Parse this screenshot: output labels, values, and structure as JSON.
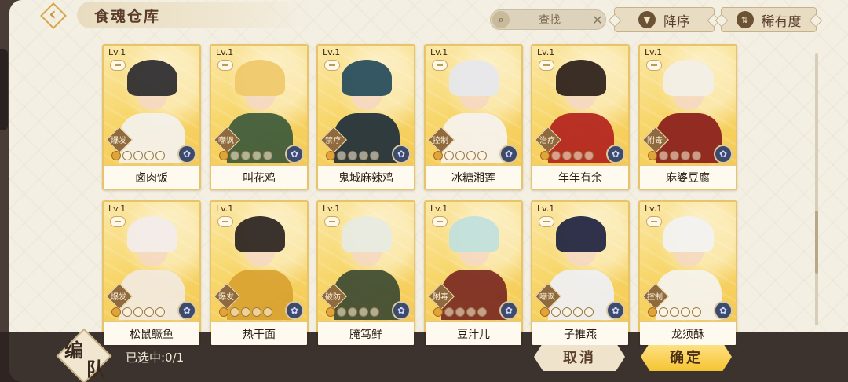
{
  "header": {
    "title": "食魂仓库",
    "search_label": "查找",
    "sort_order_label": "降序",
    "sort_rarity_label": "稀有度"
  },
  "cards": [
    {
      "level": "Lv.1",
      "name": "卤肉饭",
      "role": "爆发",
      "hair": "#2b2a2e",
      "body": "#f4f2ee"
    },
    {
      "level": "Lv.1",
      "name": "叫花鸡",
      "role": "嘲讽",
      "hair": "#f0c86a",
      "body": "#3d5a3b"
    },
    {
      "level": "Lv.1",
      "name": "鬼城麻辣鸡",
      "role": "禁疗",
      "hair": "#244a5c",
      "body": "#1f2f3a"
    },
    {
      "level": "Lv.1",
      "name": "冰糖湘莲",
      "role": "控制",
      "hair": "#e7e8ee",
      "body": "#f6f3f0"
    },
    {
      "level": "Lv.1",
      "name": "年年有余",
      "role": "治疗",
      "hair": "#2a1e1a",
      "body": "#b3231e"
    },
    {
      "level": "Lv.1",
      "name": "麻婆豆腐",
      "role": "附毒",
      "hair": "#f3efe9",
      "body": "#8a1e1c"
    },
    {
      "level": "Lv.1",
      "name": "松鼠鳜鱼",
      "role": "爆发",
      "hair": "#f2ecec",
      "body": "#f1eadf"
    },
    {
      "level": "Lv.1",
      "name": "热干面",
      "role": "爆发",
      "hair": "#2a2220",
      "body": "#d8a230"
    },
    {
      "level": "Lv.1",
      "name": "腌笃鲜",
      "role": "破防",
      "hair": "#e8ebe3",
      "body": "#3c4a32"
    },
    {
      "level": "Lv.1",
      "name": "豆汁儿",
      "role": "附毒",
      "hair": "#bfe0de",
      "body": "#7a2a22"
    },
    {
      "level": "Lv.1",
      "name": "子推燕",
      "role": "嘲讽",
      "hair": "#1e2240",
      "body": "#eef0f6"
    },
    {
      "level": "Lv.1",
      "name": "龙须酥",
      "role": "控制",
      "hair": "#f2f2f2",
      "body": "#f5f3ef"
    }
  ],
  "footer": {
    "team_char1": "编",
    "team_char2": "队",
    "selected_text": "已选中:0/1",
    "cancel_label": "取消",
    "confirm_label": "确定"
  }
}
